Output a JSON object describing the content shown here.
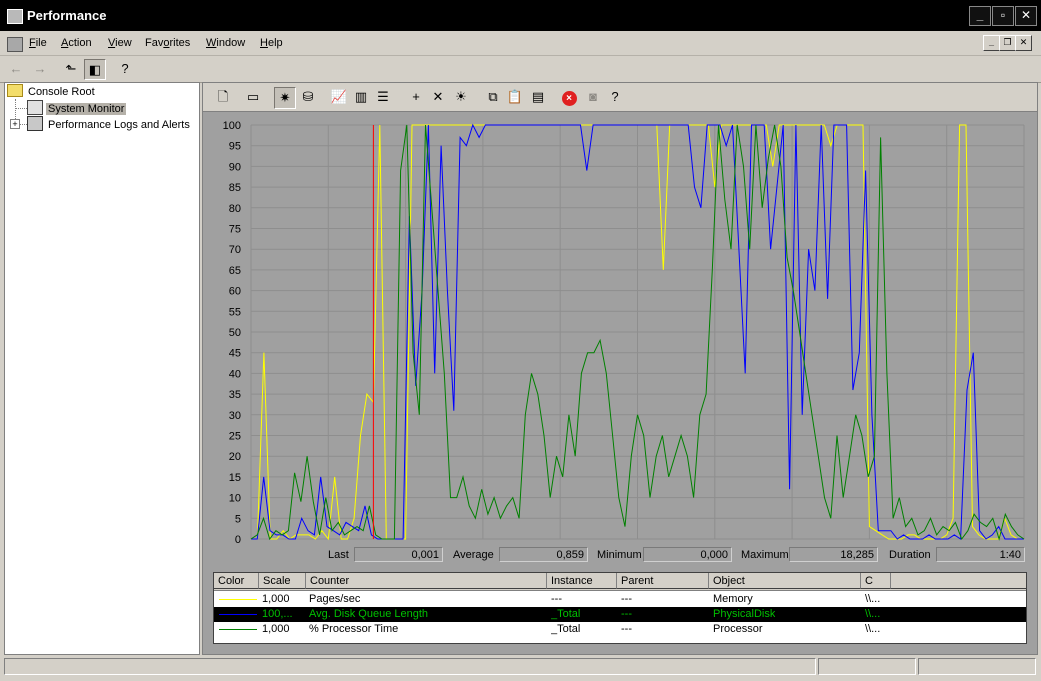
{
  "window": {
    "title": "Performance"
  },
  "menu": {
    "items": [
      {
        "pre": "",
        "ul": "F",
        "post": "ile"
      },
      {
        "pre": "",
        "ul": "A",
        "post": "ction"
      },
      {
        "pre": "",
        "ul": "V",
        "post": "iew"
      },
      {
        "pre": "Fav",
        "ul": "o",
        "post": "rites"
      },
      {
        "pre": "",
        "ul": "W",
        "post": "indow"
      },
      {
        "pre": "",
        "ul": "H",
        "post": "elp"
      }
    ]
  },
  "tree": {
    "root": "Console Root",
    "system_monitor": "System Monitor",
    "perf_logs": "Performance Logs and Alerts"
  },
  "stats": {
    "last_label": "Last",
    "last": "0,001",
    "average_label": "Average",
    "average": "0,859",
    "minimum_label": "Minimum",
    "minimum": "0,000",
    "maximum_label": "Maximum",
    "maximum": "18,285",
    "duration_label": "Duration",
    "duration": "1:40"
  },
  "legend": {
    "columns": [
      "Color",
      "Scale",
      "Counter",
      "Instance",
      "Parent",
      "Object",
      "C"
    ],
    "rows": [
      {
        "color": "#ffff00",
        "scale": "1,000",
        "counter": "Pages/sec",
        "instance": "---",
        "parent": "---",
        "object": "Memory",
        "computer": "\\\\...",
        "selected": false
      },
      {
        "color": "#0000ff",
        "scale": "100,...",
        "counter": "Avg. Disk Queue Length",
        "instance": "_Total",
        "parent": "---",
        "object": "PhysicalDisk",
        "computer": "\\\\...",
        "selected": true
      },
      {
        "color": "#008000",
        "scale": "1,000",
        "counter": "% Processor Time",
        "instance": "_Total",
        "parent": "---",
        "object": "Processor",
        "computer": "\\\\...",
        "selected": false
      }
    ]
  },
  "chart_data": {
    "type": "line",
    "ylim": [
      0,
      100
    ],
    "y_ticks": [
      "100",
      "95",
      "90",
      "85",
      "80",
      "75",
      "70",
      "65",
      "60",
      "55",
      "50",
      "45",
      "40",
      "35",
      "30",
      "25",
      "20",
      "15",
      "10",
      "5",
      "0"
    ],
    "current_sample_index": 19,
    "grid": true,
    "background": "#a0a0a0",
    "cursor_color": "#ff0000",
    "series": [
      {
        "name": "Pages/sec",
        "color": "#ffff00",
        "values": [
          0,
          0,
          45,
          0,
          0,
          2,
          0,
          1,
          1,
          1,
          0,
          2,
          0,
          15,
          0,
          0,
          5,
          25,
          35,
          33,
          100,
          0,
          0,
          0,
          0,
          100,
          100,
          100,
          100,
          100,
          100,
          100,
          100,
          100,
          100,
          100,
          100,
          100,
          100,
          100,
          100,
          100,
          100,
          100,
          100,
          100,
          100,
          100,
          100,
          100,
          100,
          100,
          100,
          100,
          100,
          100,
          100,
          100,
          100,
          100,
          100,
          100,
          100,
          100,
          65,
          100,
          100,
          100,
          100,
          100,
          100,
          100,
          85,
          100,
          100,
          100,
          100,
          100,
          100,
          100,
          100,
          90,
          100,
          100,
          100,
          100,
          100,
          100,
          100,
          100,
          95,
          100,
          100,
          100,
          100,
          100,
          3,
          2,
          1,
          0,
          0,
          0,
          1,
          1,
          0,
          0,
          0,
          0,
          1,
          5,
          100,
          100,
          3,
          1,
          0,
          0,
          0,
          5,
          1,
          0,
          0
        ]
      },
      {
        "name": "Avg. Disk Queue Length",
        "color": "#0000ff",
        "values": [
          0,
          0,
          15,
          2,
          1,
          1,
          0,
          0,
          5,
          2,
          1,
          15,
          3,
          2,
          1,
          4,
          3,
          2,
          8,
          1,
          0,
          0,
          0,
          0,
          0,
          78,
          37,
          60,
          100,
          40,
          95,
          60,
          31,
          97,
          95,
          100,
          97,
          100,
          100,
          100,
          100,
          100,
          100,
          100,
          100,
          100,
          100,
          100,
          100,
          100,
          100,
          100,
          100,
          89,
          100,
          100,
          100,
          100,
          100,
          100,
          100,
          100,
          100,
          100,
          100,
          100,
          100,
          100,
          100,
          100,
          85,
          80,
          100,
          100,
          100,
          95,
          100,
          70,
          40,
          100,
          100,
          100,
          70,
          85,
          100,
          12,
          100,
          30,
          70,
          60,
          100,
          58,
          100,
          100,
          100,
          36,
          45,
          89,
          30,
          2,
          2,
          2,
          0,
          1,
          0,
          0,
          0,
          1,
          0,
          0,
          0,
          1,
          0,
          36,
          45,
          2,
          0,
          1,
          3,
          0,
          0,
          0,
          0
        ]
      },
      {
        "name": "% Processor Time",
        "color": "#008000",
        "values": [
          0,
          1,
          5,
          0,
          2,
          1,
          2,
          16,
          9,
          20,
          9,
          1,
          10,
          2,
          4,
          1,
          2,
          3,
          2,
          8,
          1,
          0,
          0,
          0,
          89,
          100,
          45,
          30,
          100,
          80,
          60,
          40,
          10,
          10,
          15,
          8,
          5,
          12,
          6,
          10,
          5,
          8,
          10,
          5,
          30,
          40,
          35,
          25,
          10,
          20,
          15,
          30,
          20,
          40,
          45,
          45,
          48,
          40,
          25,
          10,
          3,
          20,
          30,
          25,
          10,
          20,
          25,
          15,
          20,
          25,
          20,
          10,
          30,
          35,
          65,
          100,
          82,
          70,
          100,
          90,
          70,
          100,
          80,
          92,
          100,
          90,
          68,
          60,
          50,
          40,
          30,
          20,
          10,
          5,
          25,
          10,
          20,
          30,
          25,
          15,
          20,
          97,
          40,
          5,
          10,
          3,
          5,
          1,
          2,
          5,
          1,
          3,
          2,
          4,
          0,
          2,
          6,
          4,
          3,
          5,
          0,
          6,
          3,
          1,
          0
        ]
      }
    ]
  }
}
